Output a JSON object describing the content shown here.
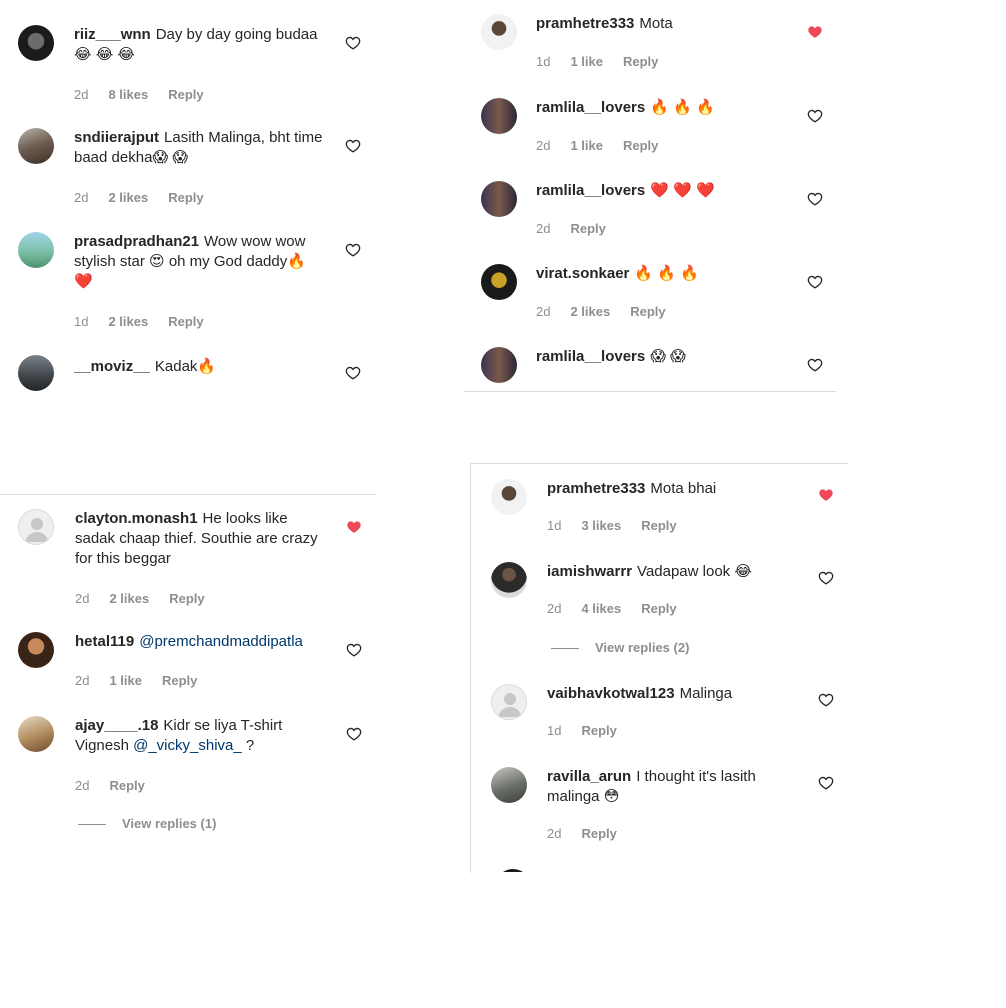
{
  "panel_top_left": {
    "comments": [
      {
        "username": "riiz___wnn",
        "text": "Day by day going budaa",
        "emojis": "😂 😂 😂",
        "time": "2d",
        "likes": "8 likes",
        "reply": "Reply",
        "liked": false
      },
      {
        "username": "sndiierajput",
        "text": "Lasith Malinga, bht time baad dekha",
        "emojis": "😱 😱",
        "time": "2d",
        "likes": "2 likes",
        "reply": "Reply",
        "liked": false
      },
      {
        "username": "prasadpradhan21",
        "text": "Wow wow wow stylish star 😍 oh my God daddy🔥",
        "emojis": "❤️",
        "time": "1d",
        "likes": "2 likes",
        "reply": "Reply",
        "liked": false
      },
      {
        "username": "__moviz__",
        "text": "Kadak🔥",
        "emojis": "",
        "time": "",
        "likes": "",
        "reply": "",
        "liked": false
      }
    ]
  },
  "panel_bottom_left": {
    "comments": [
      {
        "username": "clayton.monash1",
        "text": "He looks like sadak chaap thief. Southie are crazy for this beggar",
        "time": "2d",
        "likes": "2 likes",
        "reply": "Reply",
        "liked": true
      },
      {
        "username": "hetal119",
        "mention": "@premchandmaddipatla",
        "time": "2d",
        "likes": "1 like",
        "reply": "Reply",
        "liked": false
      },
      {
        "username": "ajay____.18",
        "text_before": "Kidr se liya T-shirt Vignesh",
        "mention": "@_vicky_shiva_",
        "text_after": "?",
        "time": "2d",
        "likes": "",
        "reply": "Reply",
        "liked": false
      }
    ],
    "view_replies": "View replies (1)"
  },
  "panel_top_right": {
    "comments": [
      {
        "username": "pramhetre333",
        "text": "Mota",
        "time": "1d",
        "likes": "1 like",
        "reply": "Reply",
        "liked": true
      },
      {
        "username": "ramlila__lovers",
        "text": "🔥 🔥 🔥",
        "time": "2d",
        "likes": "1 like",
        "reply": "Reply",
        "liked": false
      },
      {
        "username": "ramlila__lovers",
        "text": "❤️ ❤️ ❤️",
        "time": "2d",
        "likes": "",
        "reply": "Reply",
        "liked": false
      },
      {
        "username": "virat.sonkaer",
        "text": "🔥 🔥 🔥",
        "time": "2d",
        "likes": "2 likes",
        "reply": "Reply",
        "liked": false
      },
      {
        "username": "ramlila__lovers",
        "text": "😱 😱",
        "time": "",
        "likes": "",
        "reply": "",
        "liked": false
      }
    ]
  },
  "panel_bottom_right": {
    "comments": [
      {
        "username": "pramhetre333",
        "text": "Mota bhai",
        "time": "1d",
        "likes": "3 likes",
        "reply": "Reply",
        "liked": true
      },
      {
        "username": "iamishwarrr",
        "text": "Vadapaw look 😂",
        "time": "2d",
        "likes": "4 likes",
        "reply": "Reply",
        "liked": false
      },
      {
        "username": "vaibhavkotwal123",
        "text": "Malinga",
        "time": "1d",
        "likes": "",
        "reply": "Reply",
        "liked": false
      },
      {
        "username": "ravilla_arun",
        "text": "I thought it's lasith malinga 😳",
        "time": "2d",
        "likes": "",
        "reply": "Reply",
        "liked": false
      }
    ],
    "view_replies": "View replies (2)"
  },
  "colors": {
    "heart_liked": "#ed4956",
    "heart_outline": "#262626",
    "meta": "#8e8e8e",
    "mention": "#00376b"
  }
}
